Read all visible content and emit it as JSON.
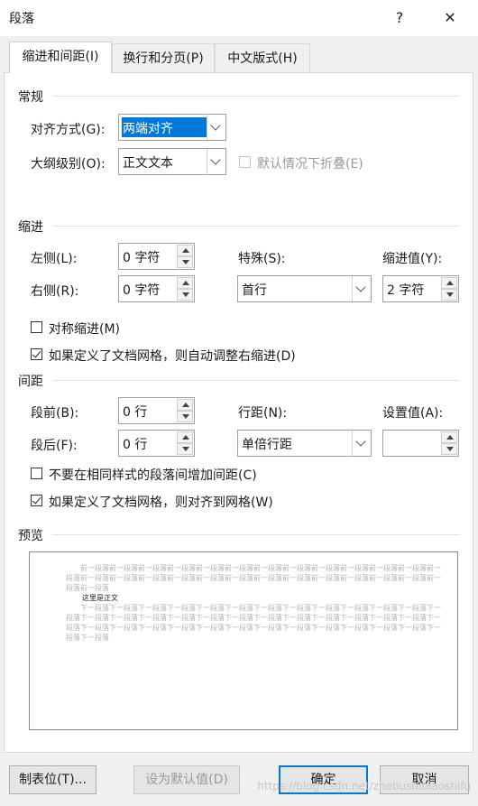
{
  "dialog": {
    "title": "段落",
    "help_glyph": "?",
    "close_glyph": "✕"
  },
  "tabs": [
    {
      "label": "缩进和间距(I)",
      "active": true
    },
    {
      "label": "换行和分页(P)",
      "active": false
    },
    {
      "label": "中文版式(H)",
      "active": false
    }
  ],
  "general": {
    "heading": "常规",
    "alignment_label": "对齐方式(G):",
    "alignment_value": "两端对齐",
    "outline_label": "大纲级别(O):",
    "outline_value": "正文文本",
    "collapse_label": "默认情况下折叠(E)"
  },
  "indent": {
    "heading": "缩进",
    "left_label": "左侧(L):",
    "left_value": "0 字符",
    "right_label": "右侧(R):",
    "right_value": "0 字符",
    "special_label": "特殊(S):",
    "special_value": "首行",
    "by_label": "缩进值(Y):",
    "by_value": "2 字符",
    "mirror_label": "对称缩进(M)",
    "auto_adjust_label": "如果定义了文档网格，则自动调整右缩进(D)"
  },
  "spacing": {
    "heading": "间距",
    "before_label": "段前(B):",
    "before_value": "0 行",
    "after_label": "段后(F):",
    "after_value": "0 行",
    "line_label": "行距(N):",
    "line_value": "单倍行距",
    "at_label": "设置值(A):",
    "at_value": "",
    "no_space_label": "不要在相同样式的段落间增加间距(C)",
    "snap_grid_label": "如果定义了文档网格，则对齐到网格(W)"
  },
  "preview": {
    "heading": "预览",
    "prev_para": "前一段落前一段落前一段落前一段落前一段落前一段落前一段落前一段落前一段落前一段落前一段落前一段落前一段落前一段落前一段落前一段落前一段落前一段落前一段落前一段落前一段落前一段落前一段落前一段落前一段落前一段落前一段落",
    "sample_text": "这里是正文",
    "next_para": "下一段落下一段落下一段落下一段落下一段落下一段落下一段落下一段落下一段落下一段落下一段落下一段落下一段落下一段落下一段落下一段落下一段落下一段落下一段落下一段落下一段落下一段落下一段落下一段落下一段落下一段落下一段落下一段落下一段落下一段落下一段落下一段落下一段落下一段落下一段落下一段落下一段落下一段落下一段落下一段落"
  },
  "buttons": {
    "tabs": "制表位(T)...",
    "set_default": "设为默认值(D)",
    "ok": "确定",
    "cancel": "取消"
  },
  "watermark": "https://blog.csdn.net/zhebushibiaoshifu",
  "colors": {
    "accent": "#0078d7",
    "selection": "#0078d7"
  }
}
